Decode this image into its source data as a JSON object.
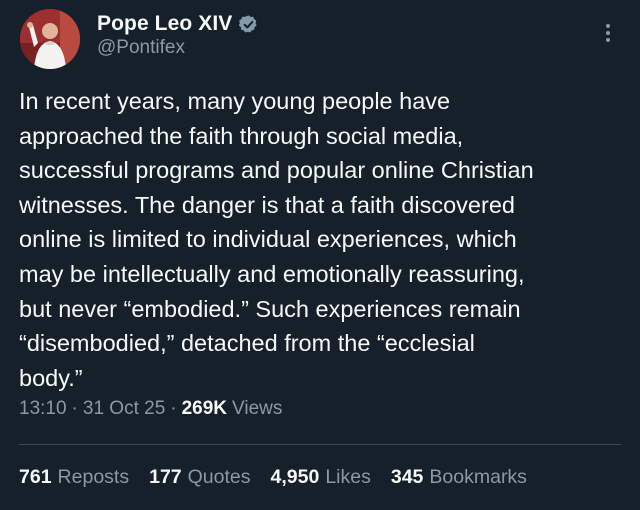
{
  "author": {
    "display_name": "Pope Leo XIV",
    "handle": "@Pontifex",
    "verified_icon": "verified-badge-icon",
    "avatar_icon": "avatar-photo"
  },
  "tweet": {
    "text": "In recent years, many young people have\napproached the faith through social media,\nsuccessful programs and popular online Christian\nwitnesses. The danger is that a faith discovered\nonline is limited to individual experiences, which\nmay be intellectually and emotionally reassuring,\nbut never “embodied.” Such experiences remain\n“disembodied,” detached from the “ecclesial\nbody.”"
  },
  "meta": {
    "time": "13:10",
    "separator": "·",
    "date": "31 Oct 25",
    "views_count": "269K",
    "views_label": "Views"
  },
  "stats": [
    {
      "count": "761",
      "label": "Reposts"
    },
    {
      "count": "177",
      "label": "Quotes"
    },
    {
      "count": "4,950",
      "label": "Likes"
    },
    {
      "count": "345",
      "label": "Bookmarks"
    }
  ],
  "colors": {
    "background": "#15202b",
    "text_primary": "#f7f9f9",
    "text_secondary": "#8b98a5",
    "divider": "#38444d",
    "verified": "#829aab"
  }
}
